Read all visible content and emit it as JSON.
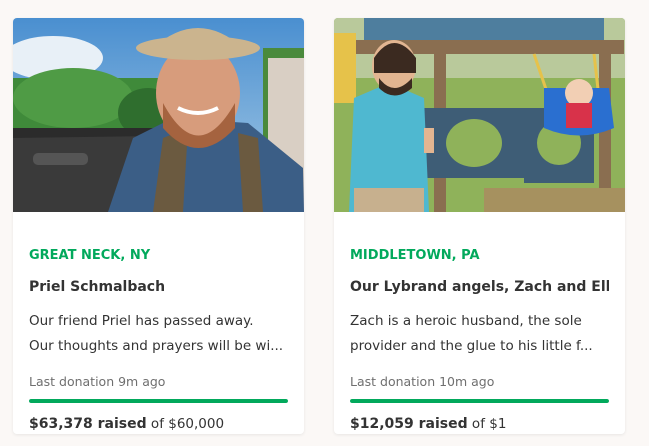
{
  "fundraisers": [
    {
      "location": "GREAT NECK, NY",
      "title": "Priel Schmalbach",
      "description_line1": "Our friend Priel has passed away.",
      "description_line2": "Our thoughts and prayers will be wi...",
      "last_donation": "Last donation 9m ago",
      "progress": 1.0,
      "raised": "$63,378 raised",
      "goal_text": " of $60,000"
    },
    {
      "location": "MIDDLETOWN, PA",
      "title": "Our Lybrand angels, Zach and Ellie",
      "description_line1": "Zach is a heroic husband, the sole",
      "description_line2": "provider and the glue to his little f...",
      "last_donation": "Last donation 10m ago",
      "progress": 1.0,
      "raised": "$12,059 raised",
      "goal_text": " of $1"
    }
  ],
  "colors": {
    "accent": "#02a95c",
    "text": "#333333",
    "muted": "#6f6f6f",
    "background": "#fbf8f6"
  }
}
